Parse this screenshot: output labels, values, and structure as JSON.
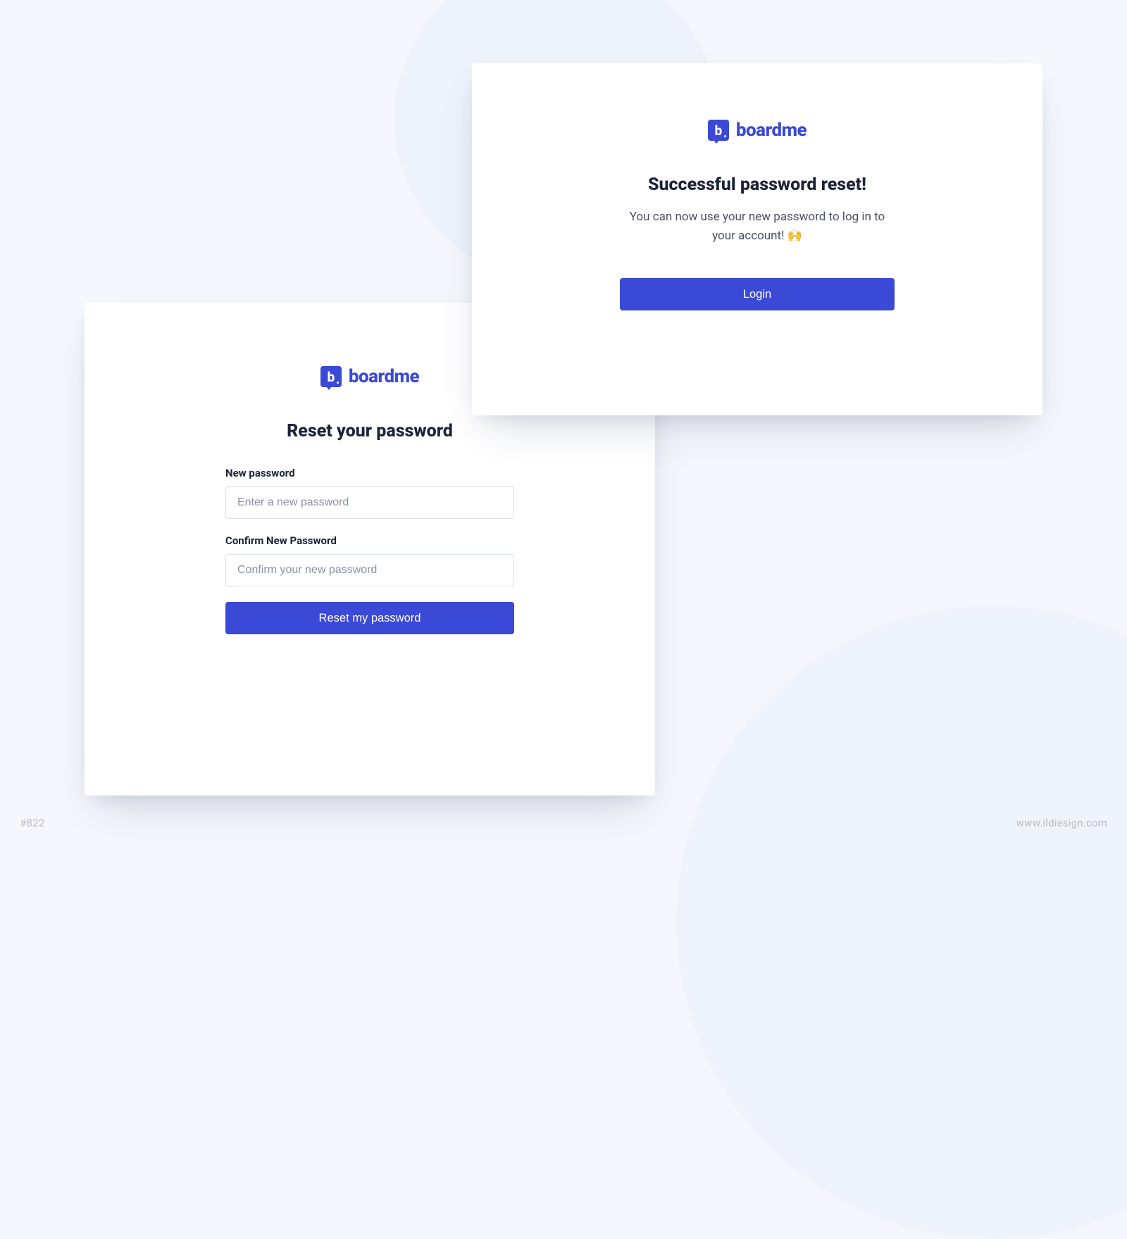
{
  "brand": {
    "name": "boardme",
    "mark_letter": "b"
  },
  "success_card": {
    "heading": "Successful password reset!",
    "subtext": "You can now use your new password to log in to your account! 🙌",
    "login_button": "Login"
  },
  "reset_card": {
    "heading": "Reset your password",
    "new_password_label": "New password",
    "new_password_placeholder": "Enter a new password",
    "confirm_password_label": "Confirm New Password",
    "confirm_password_placeholder": "Confirm your new password",
    "submit_button": "Reset my password"
  },
  "footer": {
    "left": "#822",
    "right": "www.ildiesign.com"
  },
  "colors": {
    "primary": "#3a49d6",
    "background": "#f5f7fc",
    "text_dark": "#1c2238",
    "text_muted": "#4a5168",
    "placeholder": "#8a90a6",
    "border": "#dbe0ea"
  }
}
